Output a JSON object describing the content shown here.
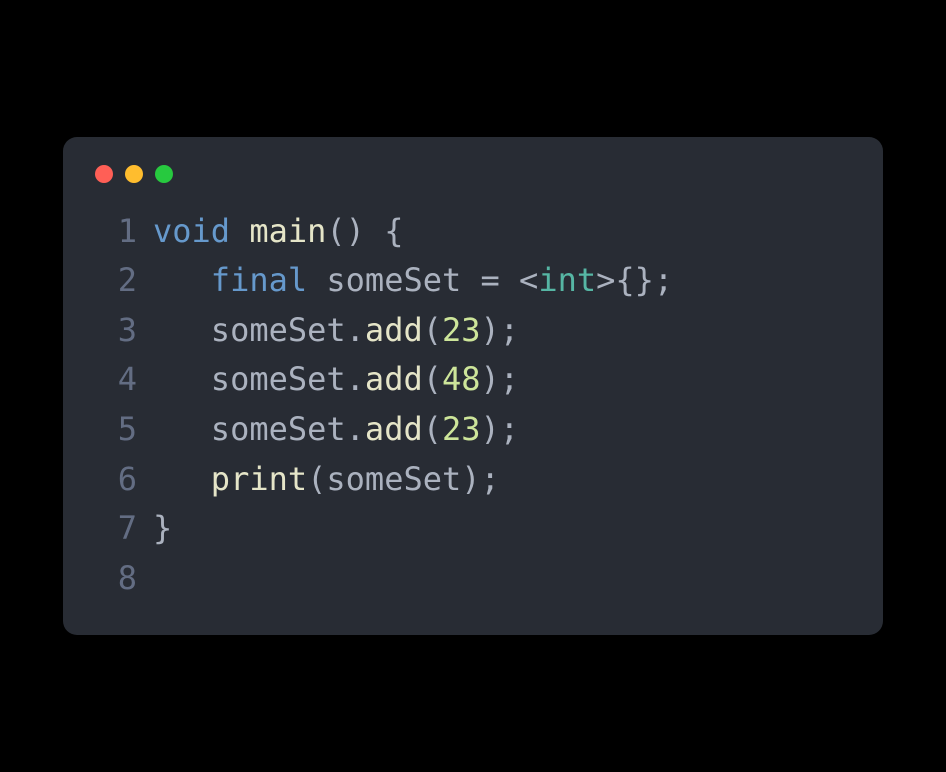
{
  "window": {
    "controls": {
      "close": "close",
      "minimize": "minimize",
      "maximize": "maximize"
    }
  },
  "code": {
    "language": "dart",
    "lines": [
      {
        "n": "1",
        "tokens": [
          {
            "t": "void",
            "c": "tok-keyword"
          },
          {
            "t": " ",
            "c": "tok-default"
          },
          {
            "t": "main",
            "c": "tok-function"
          },
          {
            "t": "()",
            "c": "tok-punct"
          },
          {
            "t": " ",
            "c": "tok-default"
          },
          {
            "t": "{",
            "c": "tok-punct"
          }
        ]
      },
      {
        "n": "2",
        "tokens": [
          {
            "t": "   ",
            "c": "tok-default"
          },
          {
            "t": "final",
            "c": "tok-keyword"
          },
          {
            "t": " someSet ",
            "c": "tok-ident"
          },
          {
            "t": "=",
            "c": "tok-punct"
          },
          {
            "t": " ",
            "c": "tok-default"
          },
          {
            "t": "<",
            "c": "tok-punct"
          },
          {
            "t": "int",
            "c": "tok-type"
          },
          {
            "t": ">{};",
            "c": "tok-punct"
          }
        ]
      },
      {
        "n": "3",
        "tokens": [
          {
            "t": "   someSet",
            "c": "tok-ident"
          },
          {
            "t": ".",
            "c": "tok-punct"
          },
          {
            "t": "add",
            "c": "tok-method"
          },
          {
            "t": "(",
            "c": "tok-punct"
          },
          {
            "t": "23",
            "c": "tok-number"
          },
          {
            "t": ");",
            "c": "tok-punct"
          }
        ]
      },
      {
        "n": "4",
        "tokens": [
          {
            "t": "   someSet",
            "c": "tok-ident"
          },
          {
            "t": ".",
            "c": "tok-punct"
          },
          {
            "t": "add",
            "c": "tok-method"
          },
          {
            "t": "(",
            "c": "tok-punct"
          },
          {
            "t": "48",
            "c": "tok-number"
          },
          {
            "t": ");",
            "c": "tok-punct"
          }
        ]
      },
      {
        "n": "5",
        "tokens": [
          {
            "t": "   someSet",
            "c": "tok-ident"
          },
          {
            "t": ".",
            "c": "tok-punct"
          },
          {
            "t": "add",
            "c": "tok-method"
          },
          {
            "t": "(",
            "c": "tok-punct"
          },
          {
            "t": "23",
            "c": "tok-number"
          },
          {
            "t": ");",
            "c": "tok-punct"
          }
        ]
      },
      {
        "n": "6",
        "tokens": [
          {
            "t": "   ",
            "c": "tok-default"
          },
          {
            "t": "print",
            "c": "tok-method"
          },
          {
            "t": "(",
            "c": "tok-punct"
          },
          {
            "t": "someSet",
            "c": "tok-ident"
          },
          {
            "t": ");",
            "c": "tok-punct"
          }
        ]
      },
      {
        "n": "7",
        "tokens": [
          {
            "t": "}",
            "c": "tok-punct"
          }
        ]
      },
      {
        "n": "8",
        "tokens": []
      }
    ]
  }
}
